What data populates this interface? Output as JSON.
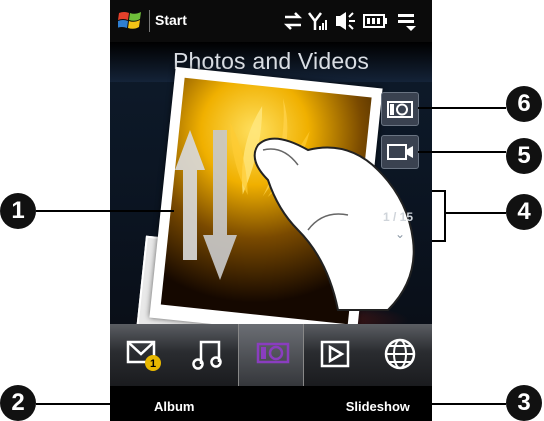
{
  "statusbar": {
    "title": "Start"
  },
  "screen": {
    "title": "Photos and Videos",
    "counter": "1 / 15"
  },
  "softkeys": {
    "left": "Album",
    "right": "Slideshow"
  },
  "callouts": [
    "1",
    "2",
    "3",
    "4",
    "5",
    "6"
  ],
  "tabs": [
    "mail-icon",
    "music-icon",
    "photos-icon",
    "play-icon",
    "internet-icon"
  ],
  "colors": {
    "accent": "#8a3dbf",
    "badge": "#e8b800"
  }
}
